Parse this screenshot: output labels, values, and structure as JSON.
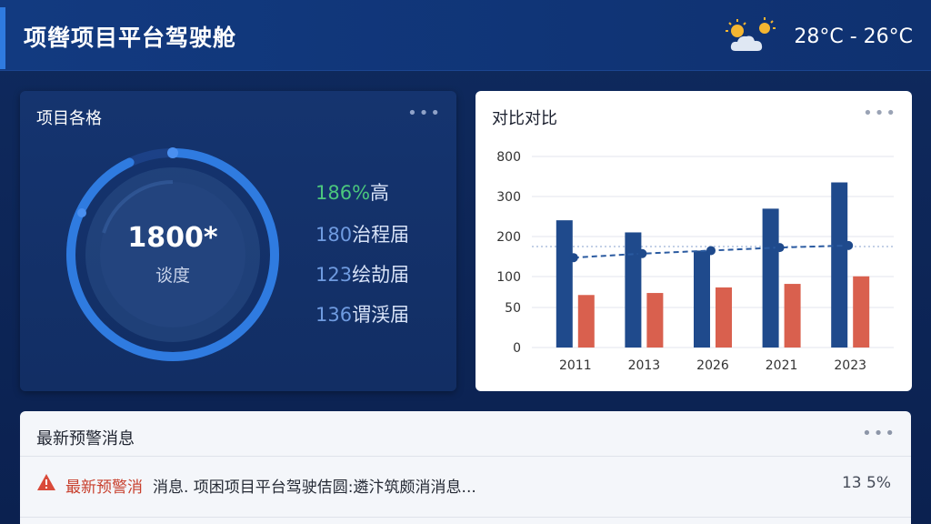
{
  "header": {
    "title": "项辔项目平台驾驶舱",
    "weather_icon": "partly-cloudy-icon",
    "temperature": "28°C - 26°C"
  },
  "overview": {
    "title": "项目各格",
    "menu_icon": "more-dots-icon",
    "gauge": {
      "value": "1800*",
      "label": "谈度",
      "progress": 0.93
    },
    "stats": [
      {
        "number": "186%",
        "label": "高"
      },
      {
        "number": "180",
        "label": "治程届"
      },
      {
        "number": "123",
        "label": "绘劼届"
      },
      {
        "number": "136",
        "label": "谓渓届"
      }
    ]
  },
  "comparison": {
    "title": "对比对比",
    "menu_icon": "more-dots-icon"
  },
  "chart_data": {
    "type": "bar",
    "title": "对比对比",
    "categories": [
      "2011",
      "2013",
      "2026",
      "2021",
      "2023"
    ],
    "series": [
      {
        "values": [
          252,
          228,
          192,
          275,
          327
        ],
        "color": "#1f4a8c"
      },
      {
        "values": [
          104,
          108,
          119,
          126,
          141
        ],
        "color": "#d9604e"
      },
      {
        "values": [
          178,
          186,
          192,
          198,
          202
        ],
        "color": "#2a5aa0",
        "kind": "line-dashed"
      }
    ],
    "y_ticks": [
      "0",
      "50",
      "100",
      "200",
      "300",
      "800"
    ],
    "ylim": [
      0,
      400
    ],
    "grid": true,
    "reference_line": 200
  },
  "alerts": {
    "title": "最新预警消息",
    "menu_icon": "more-dots-icon",
    "items": [
      {
        "icon": "warning-icon",
        "tag": "最新预警消",
        "message": "消息.  项困项目平台驾驶佶圆:遴汴筑颇消消息...",
        "value": "13 5%"
      }
    ]
  },
  "colors": {
    "accent": "#2f7be0",
    "gauge_ring": "#2f7be0",
    "positive": "#4bc77d",
    "warning": "#c8402e",
    "bar_primary": "#1f4a8c",
    "bar_secondary": "#d9604e"
  }
}
